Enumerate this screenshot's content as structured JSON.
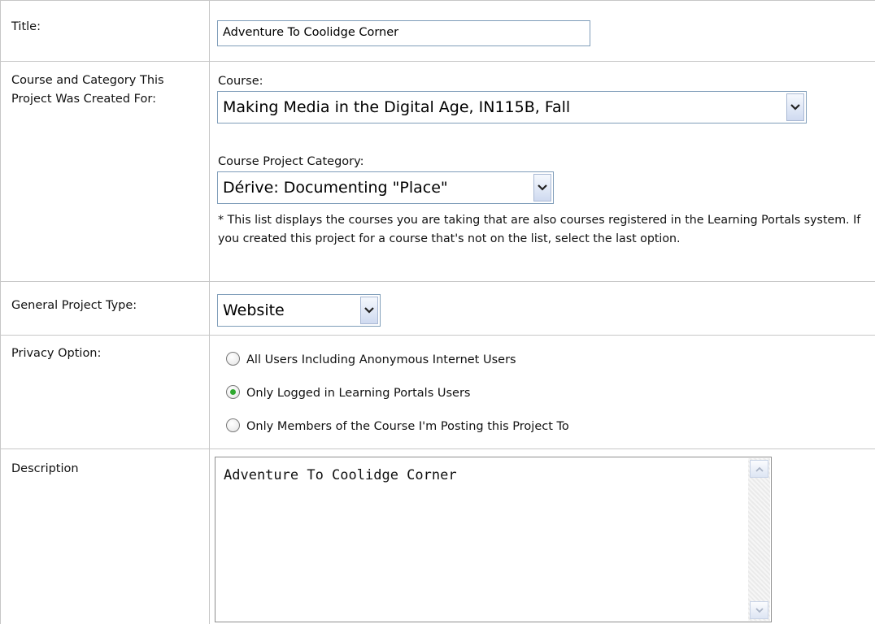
{
  "title_row": {
    "label": "Title:",
    "value": "Adventure To Coolidge Corner"
  },
  "course_row": {
    "label": "Course and Category This Project Was Created For:",
    "course_label": "Course:",
    "course_selected": "Making Media in the Digital Age, IN115B, Fall",
    "category_label": "Course Project Category:",
    "category_selected": "Dérive: Documenting \"Place\"",
    "note": "* This list displays the courses you are taking that are also courses registered in the Learning Portals system. If you created this project for a course that's not on the list, select the last option."
  },
  "type_row": {
    "label": "General Project Type:",
    "selected": "Website"
  },
  "privacy_row": {
    "label": "Privacy Option:",
    "options": [
      {
        "label": "All Users Including Anonymous Internet Users",
        "checked": false
      },
      {
        "label": "Only Logged in Learning Portals Users",
        "checked": true
      },
      {
        "label": "Only Members of the Course I'm Posting this Project To",
        "checked": false
      }
    ]
  },
  "description_row": {
    "label": "Description",
    "value": "Adventure To Coolidge Corner"
  },
  "icons": {
    "dropdown": "chevron-down-icon",
    "scroll_up": "scroll-up-arrow-icon",
    "scroll_down": "scroll-down-arrow-icon"
  },
  "colors": {
    "border": "#c7c7c7",
    "input_border": "#7f9db9",
    "radio_checked": "#2fa82f"
  }
}
